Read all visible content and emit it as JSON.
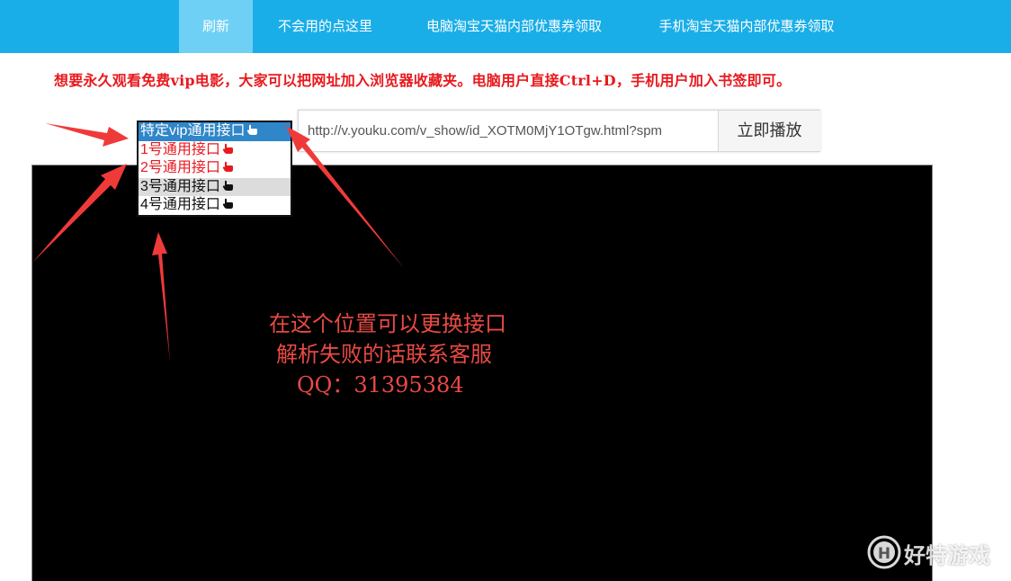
{
  "nav": {
    "items": [
      {
        "label": "刷新",
        "active": true
      },
      {
        "label": "不会用的点这里",
        "active": false
      },
      {
        "label": "电脑淘宝天猫内部优惠券领取",
        "active": false
      },
      {
        "label": "手机淘宝天猫内部优惠券领取",
        "active": false
      }
    ]
  },
  "notice": {
    "text": "想要永久观看免费vip电影，大家可以把网址加入浏览器收藏夹。电脑用户直接Ctrl+D，手机用户加入书签即可。"
  },
  "url_box": {
    "value": "http://v.youku.com/v_show/id_XOTM0MjY1OTgw.html?spm",
    "play_label": "立即播放"
  },
  "interface_select": {
    "options": [
      {
        "label": "特定vip通用接口",
        "state": "selected"
      },
      {
        "label": "1号通用接口",
        "state": "red"
      },
      {
        "label": "2号通用接口",
        "state": "red"
      },
      {
        "label": "3号通用接口",
        "state": "hover"
      },
      {
        "label": "4号通用接口",
        "state": "black"
      }
    ]
  },
  "annotation": {
    "line1": "在这个位置可以更换接口",
    "line2": "解析失败的话联系客服",
    "line3": "QQ：31395384"
  },
  "watermark": {
    "text": "好特游戏",
    "logo_letter": "H"
  },
  "colors": {
    "nav_bg": "#1aaee8",
    "nav_active": "#6fd0f5",
    "notice": "#e8191e",
    "annotation": "#e84a43",
    "arrow": "#f03a3a",
    "selected_option": "#2f86c9"
  },
  "icons": {
    "hand_pointer": "hand-pointer-icon",
    "arrow": "red-arrow-icon"
  }
}
